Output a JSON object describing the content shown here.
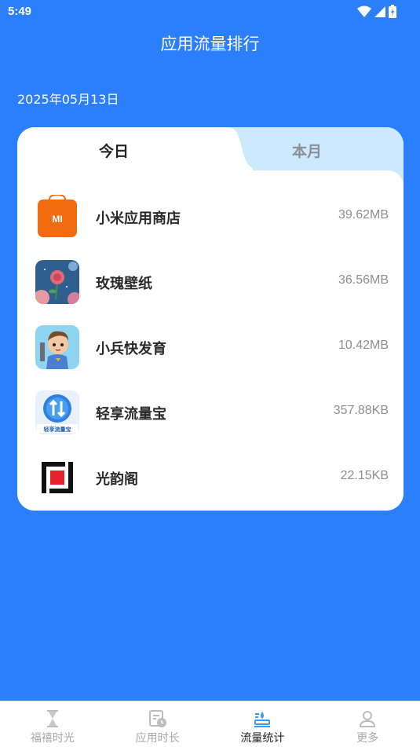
{
  "status": {
    "time": "5:49"
  },
  "header": {
    "title": "应用流量排行"
  },
  "date": "2025年05月13日",
  "tabs": [
    {
      "label": "今日",
      "active": true
    },
    {
      "label": "本月",
      "active": false
    }
  ],
  "apps": [
    {
      "name": "小米应用商店",
      "usage": "39.62MB",
      "icon": "mi-store-icon"
    },
    {
      "name": "玫瑰壁纸",
      "usage": "36.56MB",
      "icon": "rose-wallpaper-icon"
    },
    {
      "name": "小兵快发育",
      "usage": "10.42MB",
      "icon": "soldier-game-icon"
    },
    {
      "name": "轻享流量宝",
      "usage": "357.88KB",
      "icon": "traffic-treasure-icon"
    },
    {
      "name": "光韵阁",
      "usage": "22.15KB",
      "icon": "guangyunge-icon"
    }
  ],
  "icon_text": {
    "mi_logo": "MI",
    "traffic_badge": "轻享流量宝"
  },
  "nav": [
    {
      "label": "福禧时光",
      "icon": "hourglass-icon",
      "active": false
    },
    {
      "label": "应用时长",
      "icon": "app-time-icon",
      "active": false
    },
    {
      "label": "流量统计",
      "icon": "traffic-stats-icon",
      "active": true
    },
    {
      "label": "更多",
      "icon": "person-icon",
      "active": false
    }
  ],
  "colors": {
    "background": "#2b7ffd",
    "tab_inactive": "#cde9fd",
    "accent": "#3a9bf0"
  }
}
